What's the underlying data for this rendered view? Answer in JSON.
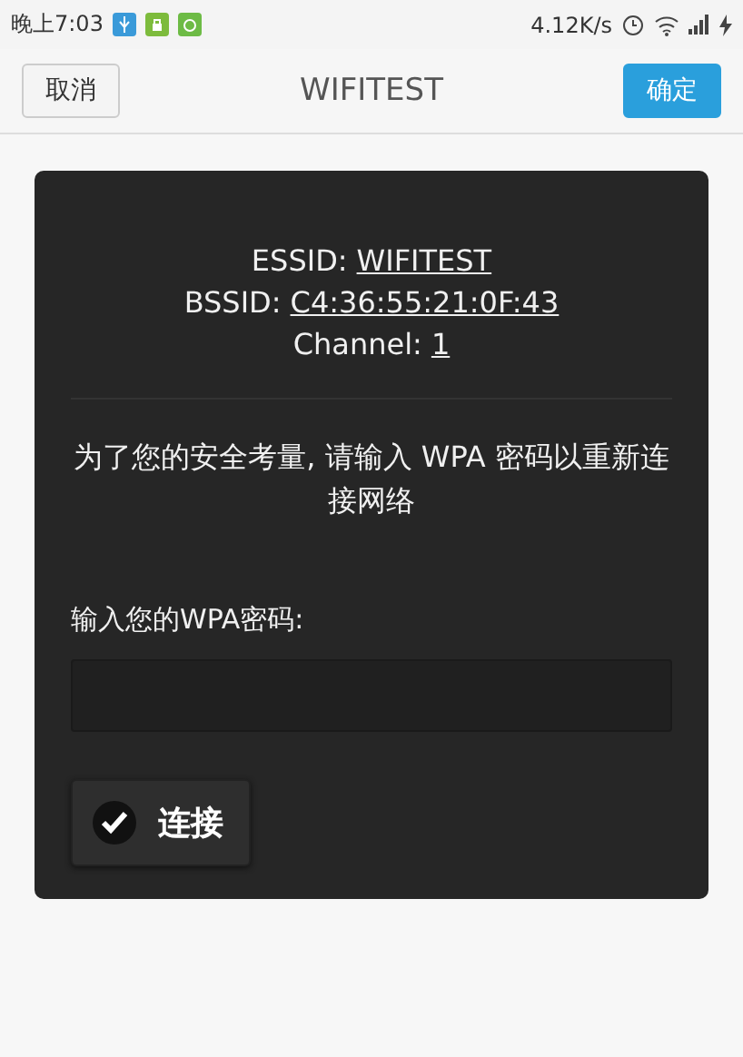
{
  "status_bar": {
    "time": "晚上7:03",
    "speed": "4.12K/s"
  },
  "header": {
    "cancel": "取消",
    "title": "WIFITEST",
    "confirm": "确定"
  },
  "network": [
    {
      "label": "ESSID:",
      "value": "WIFITEST"
    },
    {
      "label": "BSSID:",
      "value": "C4:36:55:21:0F:43"
    },
    {
      "label": "Channel:",
      "value": "1"
    }
  ],
  "message": "为了您的安全考量, 请输入 WPA 密码以重新连接网络",
  "password": {
    "label": "输入您的WPA密码:"
  },
  "connect_button": {
    "label": "连接"
  }
}
